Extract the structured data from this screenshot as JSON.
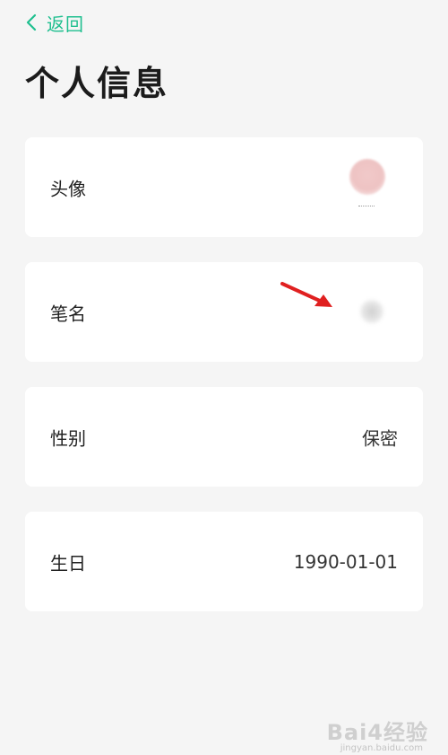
{
  "header": {
    "back_label": "返回",
    "title": "个人信息"
  },
  "rows": [
    {
      "label": "头像"
    },
    {
      "label": "笔名"
    },
    {
      "label": "性别",
      "value": "保密"
    },
    {
      "label": "生日",
      "value": "1990-01-01"
    }
  ],
  "colors": {
    "accent": "#1fbf8f",
    "background": "#f5f5f5",
    "card": "#ffffff",
    "annotation_arrow": "#e02020"
  },
  "watermark": {
    "text": "Bai4经验",
    "sub": "jingyan.baidu.com"
  }
}
